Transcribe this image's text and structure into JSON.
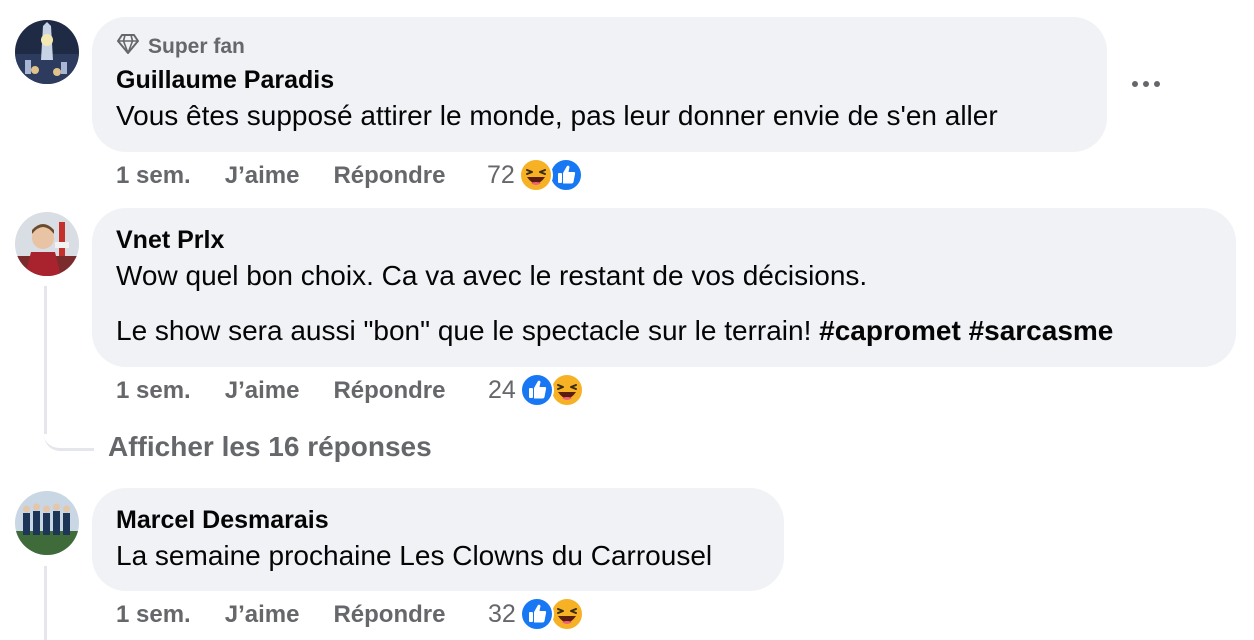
{
  "comments": [
    {
      "badge": "Super fan",
      "author": "Guillaume Paradis",
      "paragraphs": [
        "Vous êtes supposé attirer le monde, pas leur donner envie de s'en aller"
      ],
      "time": "1 sem.",
      "like_label": "J’aime",
      "reply_label": "Répondre",
      "reaction_count": "72",
      "reactions": [
        "haha",
        "like"
      ]
    },
    {
      "author": "Vnet Prlx",
      "paragraphs": [
        "Wow quel bon choix. Ca va avec le restant de vos décisions.",
        "Le show sera aussi \"bon\" que le spectacle sur le terrain! "
      ],
      "hashtags": [
        "#capromet",
        "#sarcasme"
      ],
      "time": "1 sem.",
      "like_label": "J’aime",
      "reply_label": "Répondre",
      "reaction_count": "24",
      "reactions": [
        "like",
        "haha"
      ],
      "view_replies": "Afficher les 16 réponses"
    },
    {
      "author": "Marcel Desmarais",
      "paragraphs": [
        "La semaine prochaine Les Clowns du Carrousel"
      ],
      "time": "1 sem.",
      "like_label": "J’aime",
      "reply_label": "Répondre",
      "reaction_count": "32",
      "reactions": [
        "like",
        "haha"
      ]
    }
  ],
  "colors": {
    "bubble": "#f0f2f5",
    "secondary_text": "#65676b",
    "like_blue": "#1877f2",
    "haha_yellow": "#f7b125"
  },
  "icons": {
    "badge": "diamond-icon",
    "more": "more-options-icon",
    "like": "like-reaction-icon",
    "haha": "haha-reaction-icon"
  }
}
